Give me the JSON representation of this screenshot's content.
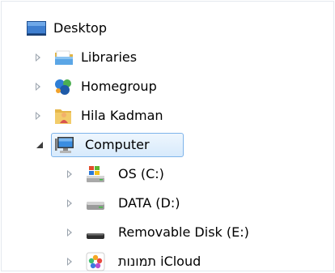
{
  "navigation_tree": {
    "items": [
      {
        "label": "Desktop",
        "icon": "desktop-icon",
        "expander": "none"
      },
      {
        "label": "Libraries",
        "icon": "libraries-icon",
        "expander": "collapsed"
      },
      {
        "label": "Homegroup",
        "icon": "homegroup-icon",
        "expander": "collapsed"
      },
      {
        "label": "Hila Kadman",
        "icon": "user-folder-icon",
        "expander": "collapsed"
      },
      {
        "label": "Computer",
        "icon": "computer-icon",
        "expander": "expanded",
        "selected": true
      },
      {
        "label": "OS (C:)",
        "icon": "windows-drive-icon",
        "expander": "collapsed"
      },
      {
        "label": "DATA (D:)",
        "icon": "hard-drive-icon",
        "expander": "collapsed"
      },
      {
        "label": "Removable Disk (E:)",
        "icon": "removable-disk-icon",
        "expander": "collapsed"
      },
      {
        "label": "תמונות iCloud",
        "icon": "icloud-photos-icon",
        "expander": "collapsed"
      }
    ]
  },
  "colors": {
    "selection_border": "#7eb4ea",
    "selection_fill": "#d7eafc",
    "expander_collapsed": "#9aa3ad",
    "expander_expanded": "#3d3d3d"
  }
}
